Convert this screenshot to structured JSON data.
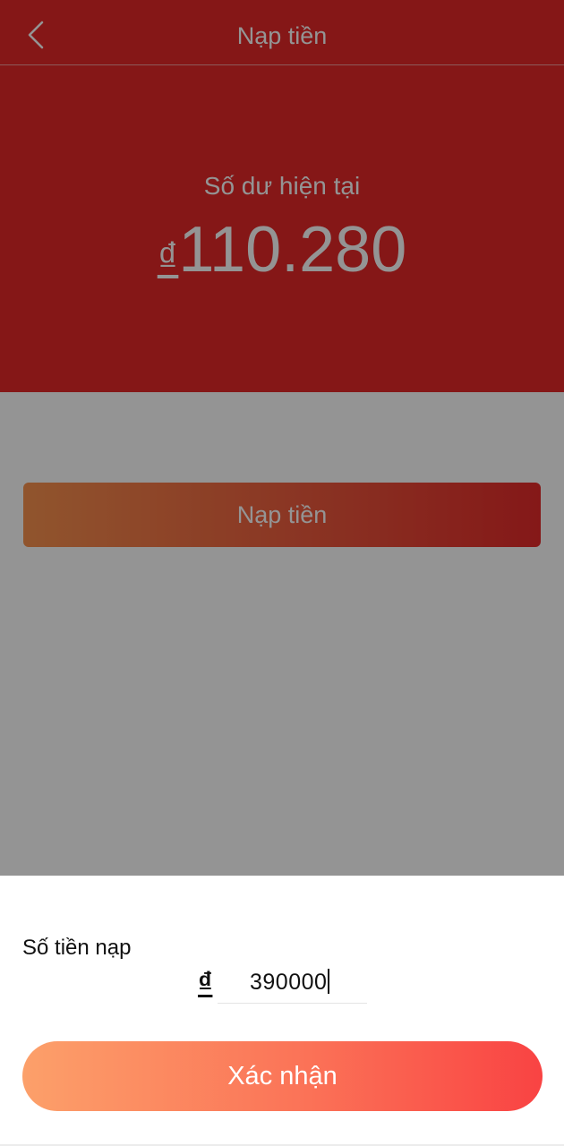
{
  "header": {
    "title": "Nạp tiền",
    "back_icon": "chevron-left-icon"
  },
  "balance": {
    "label": "Số dư hiện tại",
    "currency": "₫",
    "value": "110.280"
  },
  "main": {
    "deposit_button_label": "Nạp tiền"
  },
  "sheet": {
    "amount_label": "Số tiền nạp",
    "currency": "₫",
    "amount_value": "390000",
    "confirm_label": "Xác nhận"
  },
  "colors": {
    "brand_red": "#e52828",
    "button_gradient_start": "#fca06a",
    "button_gradient_end": "#f94343"
  }
}
